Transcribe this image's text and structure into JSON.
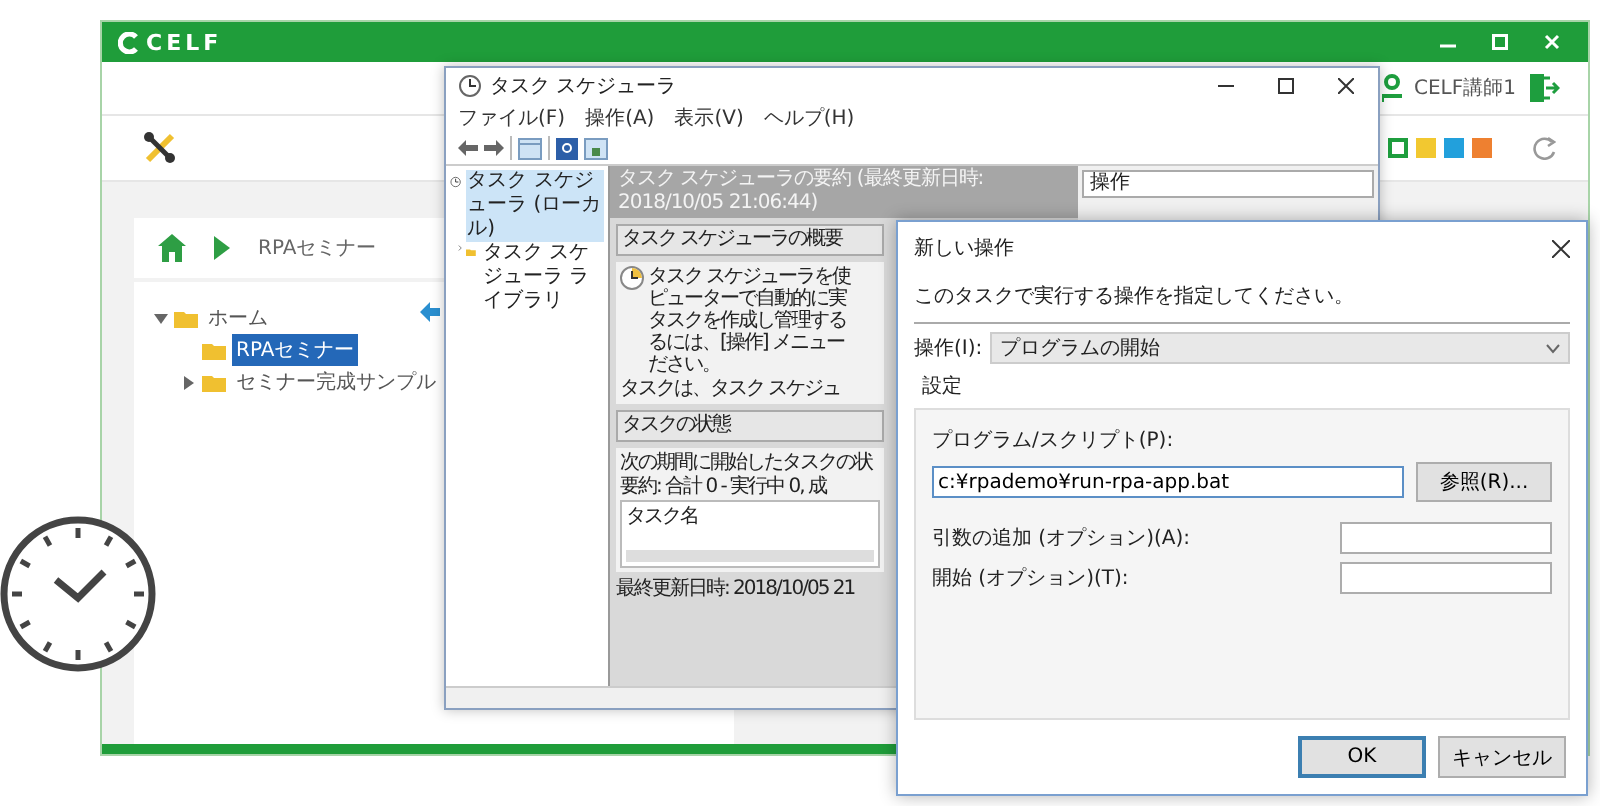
{
  "app": {
    "logo": "CELF",
    "user": "CELF講師1",
    "swatches": [
      {
        "color": "#1e9e3e",
        "selected": true
      },
      {
        "color": "#f2c830",
        "selected": false
      },
      {
        "color": "#22a0dc",
        "selected": false
      },
      {
        "color": "#ee8030",
        "selected": false
      }
    ],
    "breadcrumb": "RPAセミナー",
    "tree": [
      {
        "label": "ホーム",
        "expanded": true,
        "selected": false,
        "children": [
          {
            "label": "RPAセミナー",
            "selected": true
          },
          {
            "label": "セミナー完成サンプル",
            "expanded": false,
            "selected": false
          }
        ]
      }
    ]
  },
  "scheduler": {
    "title": "タスク スケジューラ",
    "menu": [
      "ファイル(F)",
      "操作(A)",
      "表示(V)",
      "ヘルプ(H)"
    ],
    "tree": [
      {
        "label": "タスク スケジューラ (ローカル)",
        "selected": true,
        "children": [
          {
            "label": "タスク スケジューラ ライブラリ",
            "expanded": false,
            "selected": false
          }
        ]
      }
    ],
    "summary_header": "タスク スケジューラの要約 (最終更新日時: 2018/10/05 21:06:44)",
    "overview": {
      "title": "タスク スケジューラの概要",
      "lines": [
        "タスク スケジューラを使",
        "ピューターで自動的に実",
        "タスクを作成し管理する",
        "るには、[操作] メニュー",
        "ださい。"
      ],
      "note": "タスクは、タスク スケジュ"
    },
    "state": {
      "title": "タスクの状態",
      "lines": [
        "次の期間に開始したタスクの状",
        "要約: 合計 0 - 実行中 0, 成"
      ],
      "list_header": "タスク名"
    },
    "footer": "最終更新日時: 2018/10/05 21",
    "actions_header": "操作"
  },
  "dialog": {
    "title": "新しい操作",
    "prompt": "このタスクで実行する操作を指定してください。",
    "action_label": "操作(I):",
    "action_value": "プログラムの開始",
    "group": "設定",
    "program_label": "プログラム/スクリプト(P):",
    "program_value": "c:¥rpademo¥run-rpa-app.bat",
    "browse": "参照(R)...",
    "arguments_label": "引数の追加 (オプション)(A):",
    "start_label": "開始 (オプション)(T):",
    "buttons": [
      {
        "label": "OK",
        "default": true
      },
      {
        "label": "キャンセル",
        "default": false
      }
    ]
  }
}
